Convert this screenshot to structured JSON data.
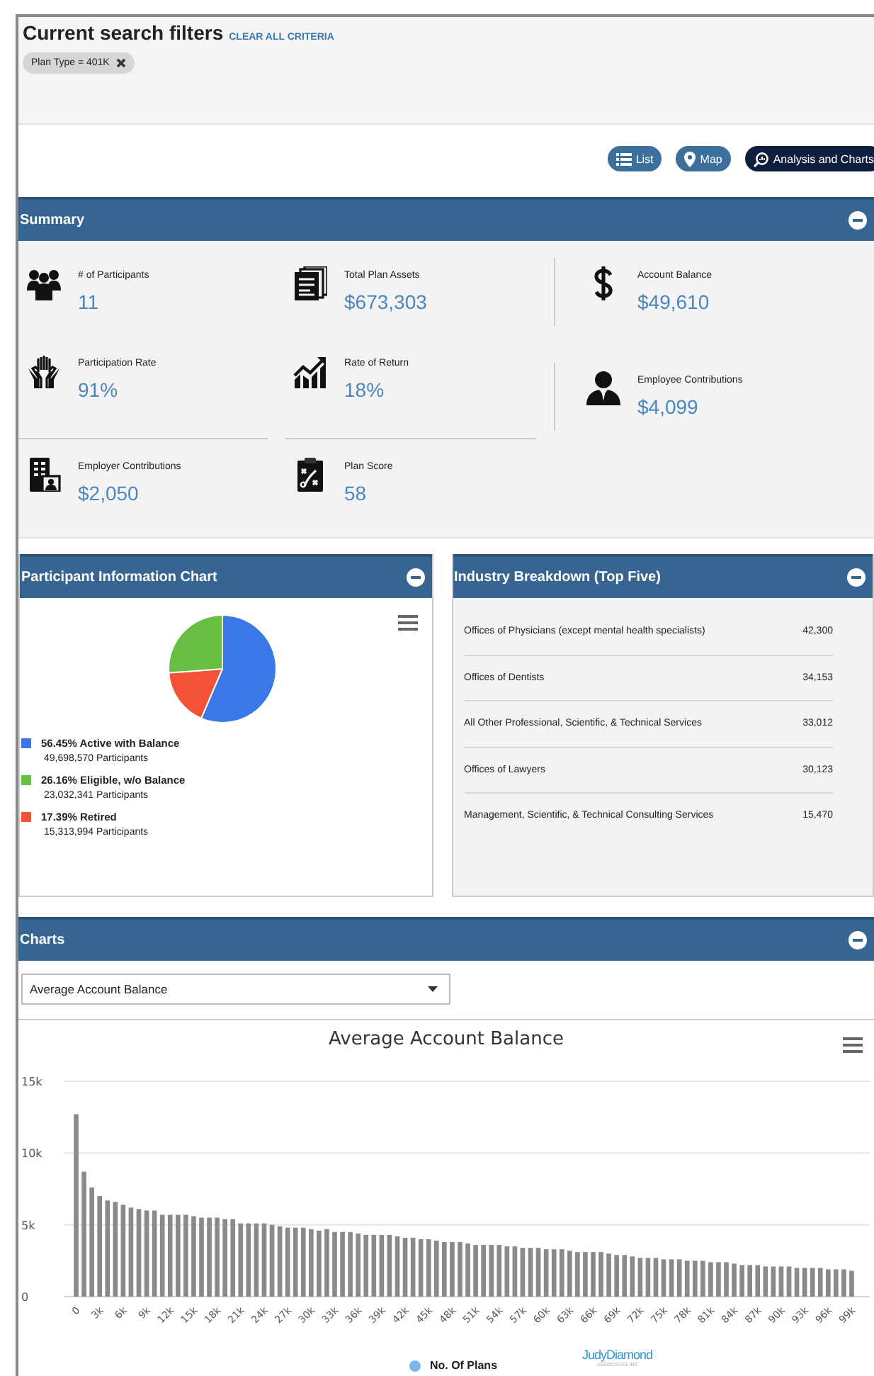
{
  "filters": {
    "title": "Current search filters",
    "clear_link": "CLEAR ALL CRITERIA",
    "chips": [
      {
        "label": "Plan Type = 401K"
      }
    ]
  },
  "view_buttons": [
    {
      "label": "List",
      "kind": "list",
      "selected": false
    },
    {
      "label": "Map",
      "kind": "map",
      "selected": false
    },
    {
      "label": "Analysis and Charts",
      "kind": "analysis",
      "selected": true
    }
  ],
  "summary": {
    "title": "Summary",
    "stats": [
      {
        "label": "# of Participants",
        "value": "11",
        "kind": "people"
      },
      {
        "label": "Total Plan Assets",
        "value": "$673,303",
        "kind": "documents"
      },
      {
        "label": "Account Balance",
        "value": "$49,610",
        "kind": "dollar"
      },
      {
        "label": "Participation Rate",
        "value": "91%",
        "kind": "hands"
      },
      {
        "label": "Rate of Return",
        "value": "18%",
        "kind": "growth"
      },
      {
        "label": "Employee Contributions",
        "value": "$4,099",
        "kind": "person"
      },
      {
        "label": "Employer Contributions",
        "value": "$2,050",
        "kind": "building"
      },
      {
        "label": "Plan Score",
        "value": "58",
        "kind": "clipboard"
      }
    ]
  },
  "participant_chart": {
    "title": "Participant Information Chart",
    "chart_data": {
      "type": "pie",
      "values": [
        56.45,
        17.39,
        26.16
      ],
      "colors": [
        "#3b78e7",
        "#f55136",
        "#67bf41"
      ]
    },
    "legend": [
      {
        "label": "56.45% Active with Balance",
        "count": "49,698,570 Participants",
        "color": "#3b78e7"
      },
      {
        "label": "26.16% Eligible, w/o Balance",
        "count": "23,032,341 Participants",
        "color": "#67bf41"
      },
      {
        "label": "17.39% Retired",
        "count": "15,313,994 Participants",
        "color": "#f55136"
      }
    ]
  },
  "industry": {
    "title": "Industry Breakdown (Top Five)",
    "rows": [
      {
        "name": "Offices of Physicians (except mental health specialists)",
        "value": "42,300"
      },
      {
        "name": "Offices of Dentists",
        "value": "34,153"
      },
      {
        "name": "All Other Professional, Scientific, & Technical Services",
        "value": "33,012"
      },
      {
        "name": "Offices of Lawyers",
        "value": "30,123"
      },
      {
        "name": "Management, Scientific, & Technical Consulting Services",
        "value": "15,470"
      }
    ]
  },
  "charts": {
    "title": "Charts",
    "select": "Average Account Balance",
    "chart_data": {
      "type": "bar",
      "title": "Average Account Balance",
      "ylim": [
        0,
        15000
      ],
      "yticks": [
        {
          "value": 0,
          "label": "0"
        },
        {
          "value": 5000,
          "label": "5k"
        },
        {
          "value": 10000,
          "label": "10k"
        },
        {
          "value": 15000,
          "label": "15k"
        }
      ],
      "xlim": [
        -500,
        99500
      ],
      "xticks": [
        {
          "value": 0,
          "label": "0"
        },
        {
          "value": 3000,
          "label": "3k"
        },
        {
          "value": 6000,
          "label": "6k"
        },
        {
          "value": 9000,
          "label": "9k"
        },
        {
          "value": 12000,
          "label": "12k"
        },
        {
          "value": 15000,
          "label": "15k"
        },
        {
          "value": 18000,
          "label": "18k"
        },
        {
          "value": 21000,
          "label": "21k"
        },
        {
          "value": 24000,
          "label": "24k"
        },
        {
          "value": 27000,
          "label": "27k"
        },
        {
          "value": 30000,
          "label": "30k"
        },
        {
          "value": 33000,
          "label": "33k"
        },
        {
          "value": 36000,
          "label": "36k"
        },
        {
          "value": 39000,
          "label": "39k"
        },
        {
          "value": 42000,
          "label": "42k"
        },
        {
          "value": 45000,
          "label": "45k"
        },
        {
          "value": 48000,
          "label": "48k"
        },
        {
          "value": 51000,
          "label": "51k"
        },
        {
          "value": 54000,
          "label": "54k"
        },
        {
          "value": 57000,
          "label": "57k"
        },
        {
          "value": 60000,
          "label": "60k"
        },
        {
          "value": 63000,
          "label": "63k"
        },
        {
          "value": 66000,
          "label": "66k"
        },
        {
          "value": 69000,
          "label": "69k"
        },
        {
          "value": 72000,
          "label": "72k"
        },
        {
          "value": 75000,
          "label": "75k"
        },
        {
          "value": 78000,
          "label": "78k"
        },
        {
          "value": 81000,
          "label": "81k"
        },
        {
          "value": 84000,
          "label": "84k"
        },
        {
          "value": 87000,
          "label": "87k"
        },
        {
          "value": 90000,
          "label": "90k"
        },
        {
          "value": 93000,
          "label": "93k"
        },
        {
          "value": 96000,
          "label": "96k"
        },
        {
          "value": 99000,
          "label": "99k"
        }
      ],
      "x": [
        0,
        1000,
        2000,
        3000,
        4000,
        5000,
        6000,
        7000,
        8000,
        9000,
        10000,
        11000,
        12000,
        13000,
        14000,
        15000,
        16000,
        17000,
        18000,
        19000,
        20000,
        21000,
        22000,
        23000,
        24000,
        25000,
        26000,
        27000,
        28000,
        29000,
        30000,
        31000,
        32000,
        33000,
        34000,
        35000,
        36000,
        37000,
        38000,
        39000,
        40000,
        41000,
        42000,
        43000,
        44000,
        45000,
        46000,
        47000,
        48000,
        49000,
        50000,
        51000,
        52000,
        53000,
        54000,
        55000,
        56000,
        57000,
        58000,
        59000,
        60000,
        61000,
        62000,
        63000,
        64000,
        65000,
        66000,
        67000,
        68000,
        69000,
        70000,
        71000,
        72000,
        73000,
        74000,
        75000,
        76000,
        77000,
        78000,
        79000,
        80000,
        81000,
        82000,
        83000,
        84000,
        85000,
        86000,
        87000,
        88000,
        89000,
        90000,
        91000,
        92000,
        93000,
        94000,
        95000,
        96000,
        97000,
        98000,
        99000
      ],
      "series": [
        {
          "name": "No. Of Plans",
          "color": "#8a8a8a",
          "values": [
            12700,
            8700,
            7600,
            7000,
            6700,
            6600,
            6400,
            6200,
            6100,
            6000,
            6000,
            5700,
            5700,
            5700,
            5700,
            5600,
            5500,
            5500,
            5500,
            5400,
            5400,
            5100,
            5100,
            5100,
            5100,
            5000,
            4900,
            4800,
            4800,
            4800,
            4700,
            4600,
            4700,
            4500,
            4500,
            4500,
            4400,
            4300,
            4300,
            4300,
            4300,
            4200,
            4100,
            4100,
            4000,
            4000,
            3900,
            3800,
            3800,
            3800,
            3700,
            3600,
            3600,
            3600,
            3600,
            3500,
            3500,
            3400,
            3400,
            3400,
            3300,
            3300,
            3300,
            3200,
            3100,
            3100,
            3100,
            3100,
            3000,
            2900,
            2900,
            2800,
            2700,
            2700,
            2700,
            2600,
            2600,
            2600,
            2500,
            2500,
            2500,
            2400,
            2400,
            2400,
            2300,
            2200,
            2200,
            2200,
            2100,
            2100,
            2100,
            2100,
            2000,
            2000,
            2000,
            2000,
            1900,
            1900,
            1900,
            1800
          ]
        }
      ]
    },
    "legend_dot": {
      "color": "#7cb5ec"
    },
    "credit": {
      "name": "JudyDiamond",
      "sub": "ASSOCIATES INC"
    }
  }
}
